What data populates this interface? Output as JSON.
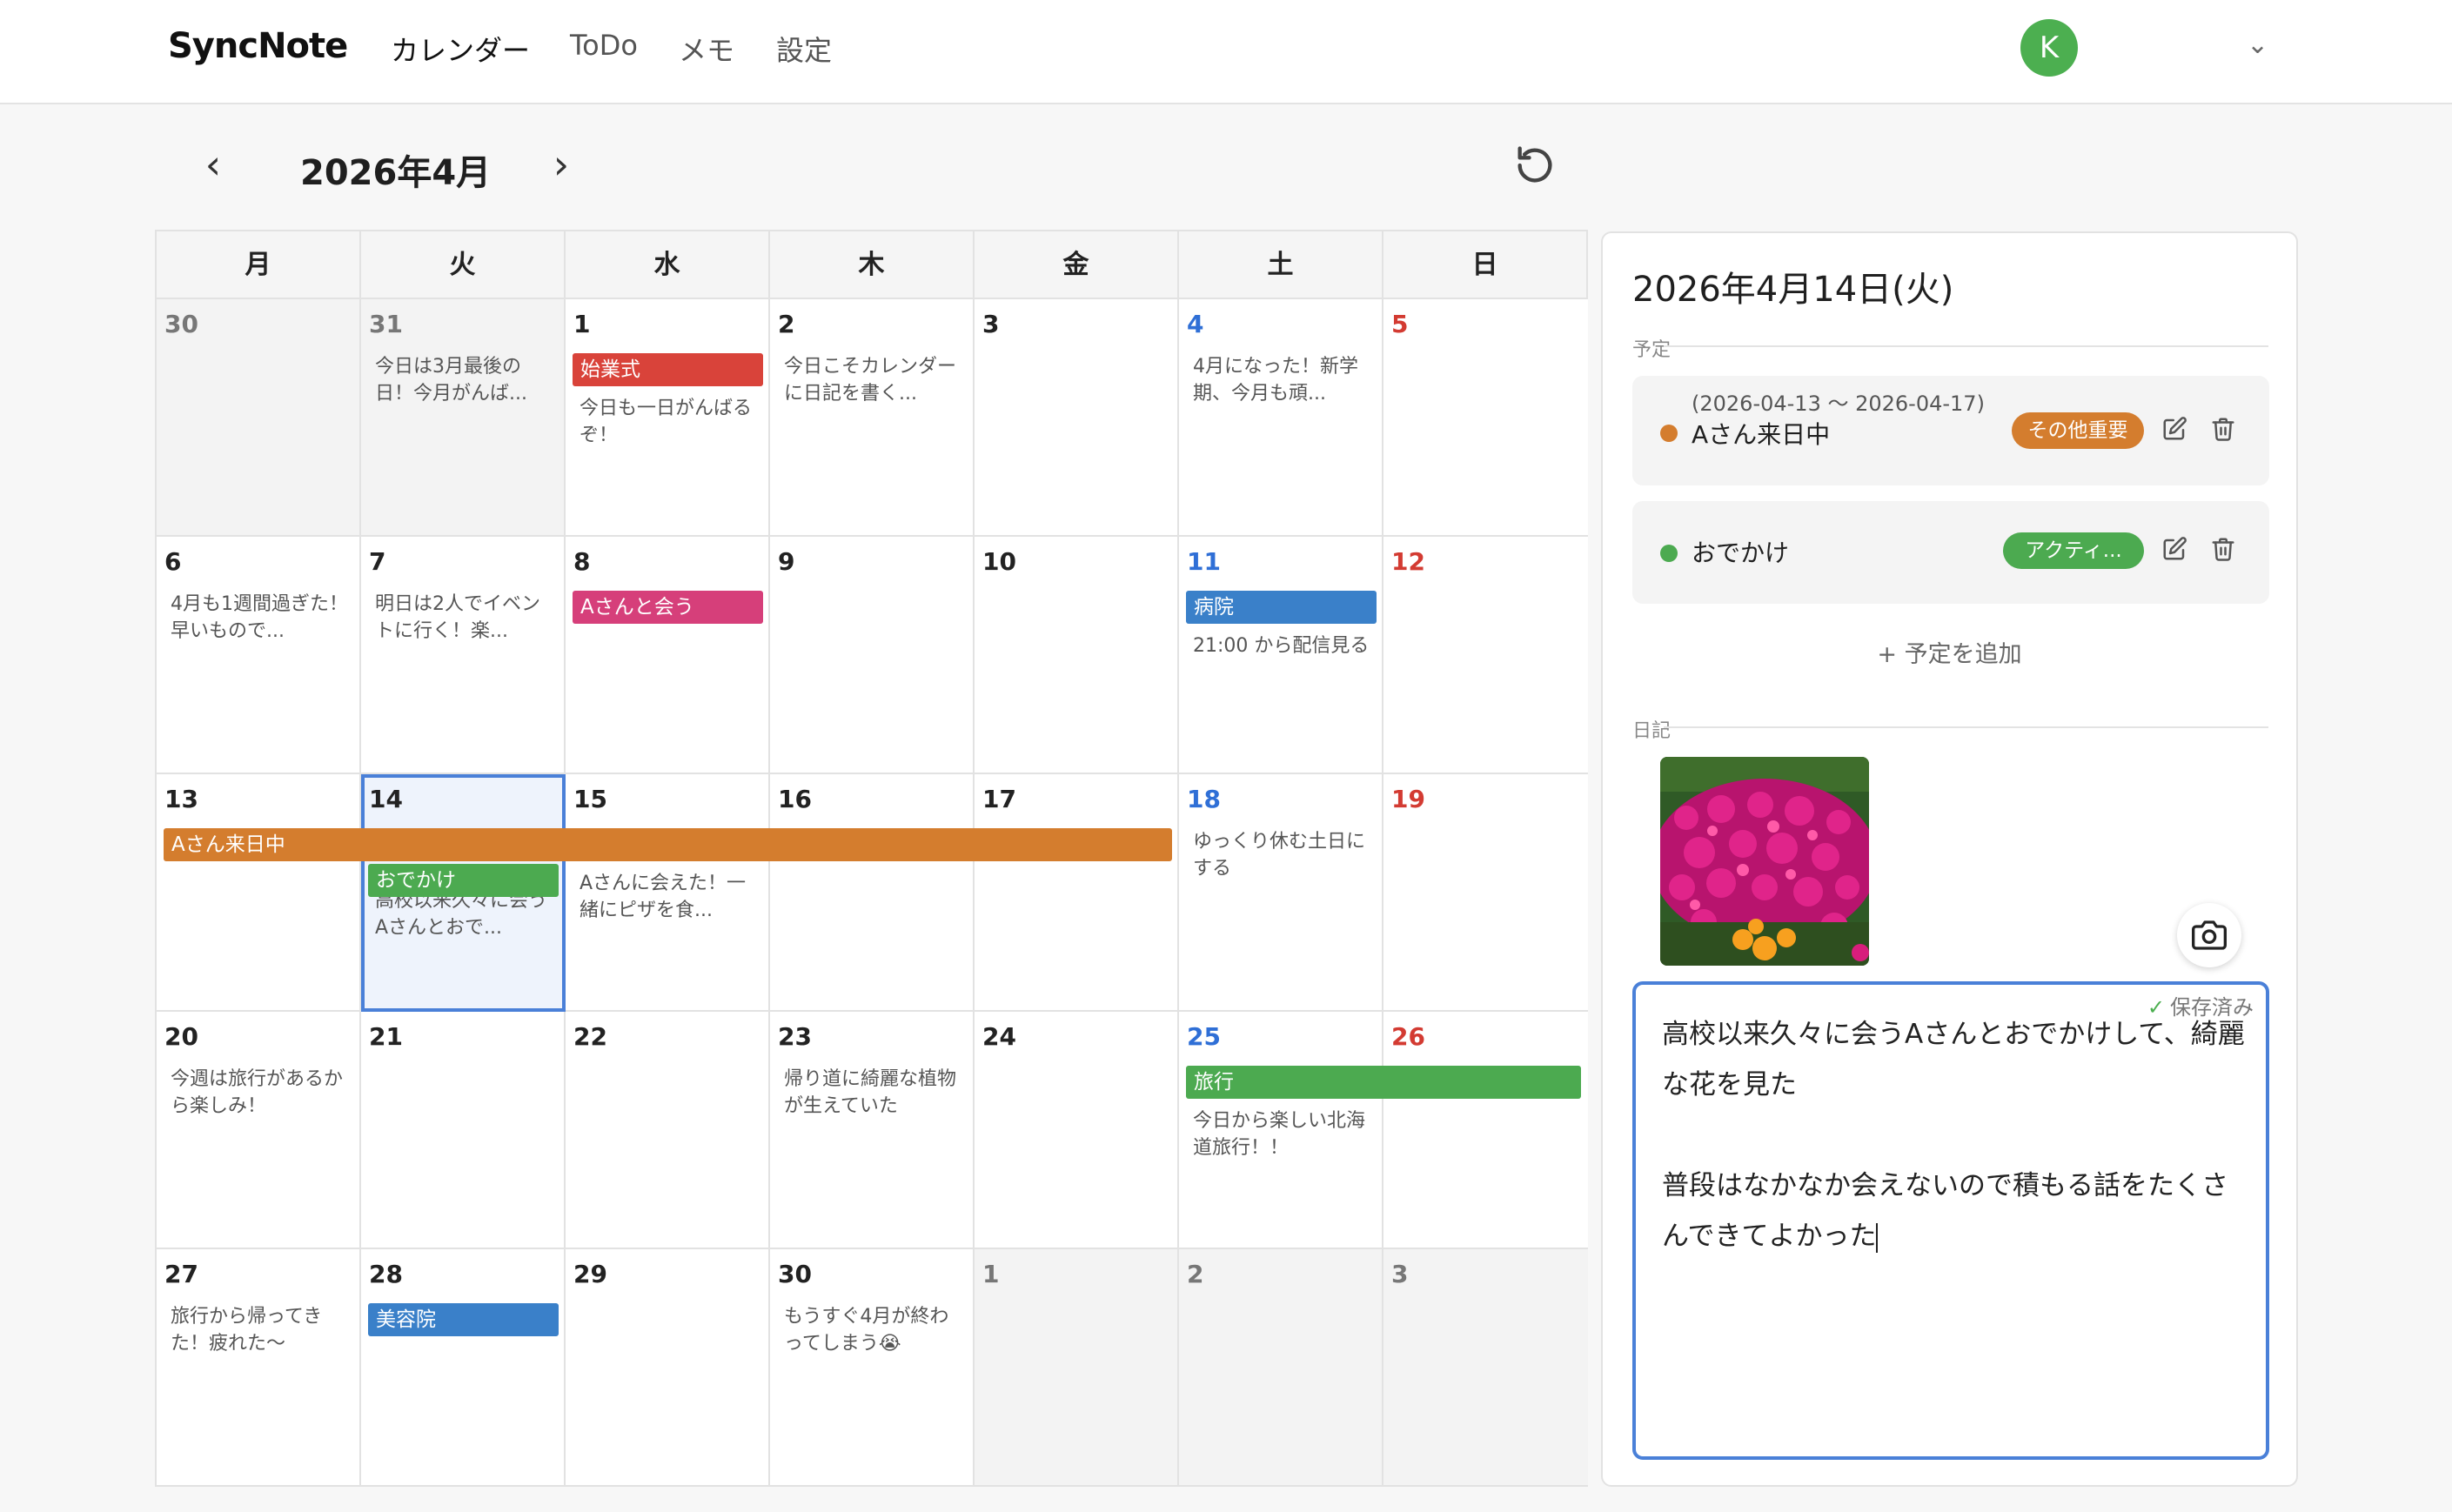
{
  "app": {
    "brand": "SyncNote",
    "nav": [
      {
        "label": "カレンダー"
      },
      {
        "label": "ToDo"
      },
      {
        "label": "メモ"
      },
      {
        "label": "設定"
      }
    ],
    "user_initial": "K",
    "user_menu_glyph": "⌄"
  },
  "calendar": {
    "title": "2026年4月",
    "prev_glyph": "‹",
    "next_glyph": "›",
    "weekdays": [
      "月",
      "火",
      "水",
      "木",
      "金",
      "土",
      "日"
    ],
    "days": [
      {
        "n": "30",
        "other": true,
        "diary": ""
      },
      {
        "n": "31",
        "other": true,
        "diary": "今日は3月最後の日！今月がんば..."
      },
      {
        "n": "1",
        "diary": "今日も一日がんばるぞ！"
      },
      {
        "n": "2",
        "diary": "今日こそカレンダーに日記を書く..."
      },
      {
        "n": "3",
        "diary": ""
      },
      {
        "n": "4",
        "wk": "sat",
        "diary": "4月になった！新学期、今月も頑..."
      },
      {
        "n": "5",
        "wk": "sun",
        "diary": ""
      },
      {
        "n": "6",
        "diary": "4月も1週間過ぎた！早いもので..."
      },
      {
        "n": "7",
        "diary": "明日は2人でイベントに行く！楽..."
      },
      {
        "n": "8",
        "diary": ""
      },
      {
        "n": "9",
        "diary": ""
      },
      {
        "n": "10",
        "diary": ""
      },
      {
        "n": "11",
        "wk": "sat",
        "diary": "21:00 から配信見る"
      },
      {
        "n": "12",
        "wk": "sun",
        "diary": ""
      },
      {
        "n": "13",
        "diary": ""
      },
      {
        "n": "14",
        "selected": true,
        "diary": "高校以来久々に会うAさんとおで..."
      },
      {
        "n": "15",
        "diary": "Aさんに会えた！一緒にピザを食..."
      },
      {
        "n": "16",
        "diary": ""
      },
      {
        "n": "17",
        "diary": ""
      },
      {
        "n": "18",
        "wk": "sat",
        "diary": "ゆっくり休む土日にする"
      },
      {
        "n": "19",
        "wk": "sun",
        "diary": ""
      },
      {
        "n": "20",
        "diary": "今週は旅行があるから楽しみ！"
      },
      {
        "n": "21",
        "diary": ""
      },
      {
        "n": "22",
        "diary": ""
      },
      {
        "n": "23",
        "diary": "帰り道に綺麗な植物が生えていた"
      },
      {
        "n": "24",
        "diary": ""
      },
      {
        "n": "25",
        "wk": "sat",
        "diary": "今日から楽しい北海道旅行！！"
      },
      {
        "n": "26",
        "wk": "sun",
        "diary": ""
      },
      {
        "n": "27",
        "diary": "旅行から帰ってきた！疲れた〜"
      },
      {
        "n": "28",
        "diary": ""
      },
      {
        "n": "29",
        "diary": ""
      },
      {
        "n": "30",
        "diary": "もうすぐ4月が終わってしまう😭"
      },
      {
        "n": "1",
        "other": true,
        "diary": ""
      },
      {
        "n": "2",
        "other": true,
        "diary": ""
      },
      {
        "n": "3",
        "other": true,
        "diary": ""
      }
    ],
    "events": [
      {
        "label": "始業式",
        "color": "#d9433a",
        "week": 0,
        "col": 2,
        "span": 1,
        "slot": 0
      },
      {
        "label": "Aさんと会う",
        "color": "#d63f7a",
        "week": 1,
        "col": 2,
        "span": 1,
        "slot": 0
      },
      {
        "label": "病院",
        "color": "#3a80c9",
        "week": 1,
        "col": 5,
        "span": 1,
        "slot": 0
      },
      {
        "label": "Aさん来日中",
        "color": "#d47d2e",
        "week": 2,
        "col": 0,
        "span": 5,
        "slot": 0
      },
      {
        "label": "おでかけ",
        "color": "#4caa50",
        "week": 2,
        "col": 1,
        "span": 1,
        "slot": 1
      },
      {
        "label": "旅行",
        "color": "#4caa50",
        "week": 3,
        "col": 5,
        "span": 2,
        "slot": 0
      },
      {
        "label": "美容院",
        "color": "#3a80c9",
        "week": 4,
        "col": 1,
        "span": 1,
        "slot": 0
      }
    ]
  },
  "panel": {
    "date_title": "2026年4月14日(火)",
    "schedule_label": "予定",
    "events": [
      {
        "range": "(2026-04-13 〜 2026-04-17)",
        "title": "Aさん来日中",
        "dot_color": "#d47d2e",
        "tag": "その他重要",
        "tag_color": "#d47d2e"
      },
      {
        "range": "",
        "title": "おでかけ",
        "dot_color": "#4caa50",
        "tag": "アクティ...",
        "tag_color": "#4caa50"
      }
    ],
    "add_event_label": "+ 予定を追加",
    "diary_label": "日記",
    "saved_label": "保存済み",
    "diary_text": "高校以来久々に会うAさんとおでかけして、綺麗な花を見た\n\n普段はなかなか会えないので積もる話をたくさんできてよかった"
  },
  "colors": {
    "accent": "#4a80d8",
    "saturday": "#2f6fd6",
    "sunday": "#d33b32",
    "avatar": "#4caf50"
  },
  "icons": [
    "chevron-left-icon",
    "chevron-right-icon",
    "refresh-icon",
    "edit-icon",
    "trash-icon",
    "camera-icon",
    "chevron-down-icon"
  ]
}
